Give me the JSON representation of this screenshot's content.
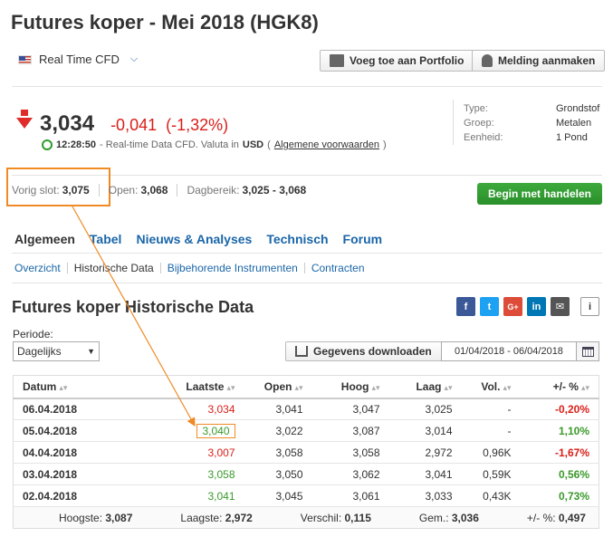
{
  "page": {
    "title": "Futures koper - Mei 2018 (HGK8)",
    "realtime_label": "Real Time CFD",
    "portfolio_btn": "Voeg toe aan Portfolio",
    "alert_btn": "Melding aanmaken"
  },
  "quote": {
    "price": "3,034",
    "change": "-0,041",
    "change_pct": "(-1,32%)",
    "time": "12:28:50",
    "note": " - Real-time Data CFD. Valuta in ",
    "currency": "USD",
    "paren_open": " (",
    "terms_link": "Algemene voorwaarden",
    "paren_close": " )"
  },
  "properties": {
    "labels": [
      "Type:",
      "Groep:",
      "Eenheid:"
    ],
    "values": [
      "Grondstof",
      "Metalen",
      "1 Pond"
    ]
  },
  "stats": {
    "prev_close_label": "Vorig slot:",
    "prev_close": "3,075",
    "open_label": "Open:",
    "open": "3,068",
    "range_label": "Dagbereik:",
    "range": "3,025 - 3,068",
    "trade_btn": "Begin met handelen"
  },
  "tabs": [
    "Algemeen",
    "Tabel",
    "Nieuws & Analyses",
    "Technisch",
    "Forum"
  ],
  "subtabs": [
    "Overzicht",
    "Historische Data",
    "Bijbehorende Instrumenten",
    "Contracten"
  ],
  "historical": {
    "heading": "Futures koper Historische Data",
    "period_label": "Periode:",
    "period_value": "Dagelijks",
    "download_btn": "Gegevens downloaden",
    "date_range": "01/04/2018 - 06/04/2018",
    "columns": [
      "Datum",
      "Laatste",
      "Open",
      "Hoog",
      "Laag",
      "Vol.",
      "+/- %"
    ],
    "rows": [
      {
        "date": "06.04.2018",
        "last": "3,034",
        "open": "3,041",
        "high": "3,047",
        "low": "3,025",
        "vol": "-",
        "pct": "-0,20%"
      },
      {
        "date": "05.04.2018",
        "last": "3,040",
        "open": "3,022",
        "high": "3,087",
        "low": "3,014",
        "vol": "-",
        "pct": "1,10%"
      },
      {
        "date": "04.04.2018",
        "last": "3,007",
        "open": "3,058",
        "high": "3,058",
        "low": "2,972",
        "vol": "0,96K",
        "pct": "-1,67%"
      },
      {
        "date": "03.04.2018",
        "last": "3,058",
        "open": "3,050",
        "high": "3,062",
        "low": "3,041",
        "vol": "0,59K",
        "pct": "0,56%"
      },
      {
        "date": "02.04.2018",
        "last": "3,041",
        "open": "3,045",
        "high": "3,061",
        "low": "3,033",
        "vol": "0,43K",
        "pct": "0,73%"
      }
    ],
    "footer": {
      "high_label": "Hoogste:",
      "high": "3,087",
      "low_label": "Laagste:",
      "low": "2,972",
      "diff_label": "Verschil:",
      "diff": "0,115",
      "avg_label": "Gem.:",
      "avg": "3,036",
      "pct_label": "+/- %:",
      "pct": "0,497"
    }
  },
  "social": [
    "f",
    "t",
    "G+",
    "in",
    "✉",
    "i"
  ],
  "colors": {
    "red": "#d91e18",
    "green": "#3a9a2a",
    "link": "#1a66a8",
    "highlight": "#f08a24"
  }
}
